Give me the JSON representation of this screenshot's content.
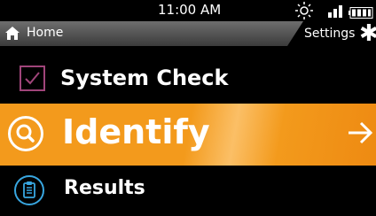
{
  "status_bar": {
    "time": "11:00 AM",
    "icons": [
      "sun-icon",
      "signal-icon",
      "battery-icon"
    ]
  },
  "nav": {
    "home_label": "Home",
    "settings_label": "Settings"
  },
  "menu": {
    "system_check": {
      "label": "System Check",
      "icon": "checkbox-icon"
    },
    "identify": {
      "label": "Identify",
      "icon": "search-icon",
      "arrow": "arrow-right-icon"
    },
    "results": {
      "label": "Results",
      "icon": "clipboard-icon"
    }
  },
  "colors": {
    "accent_orange": "#f39a1c",
    "checkbox_purple": "#a0457a",
    "results_blue": "#38a6e0",
    "background": "#000000"
  }
}
